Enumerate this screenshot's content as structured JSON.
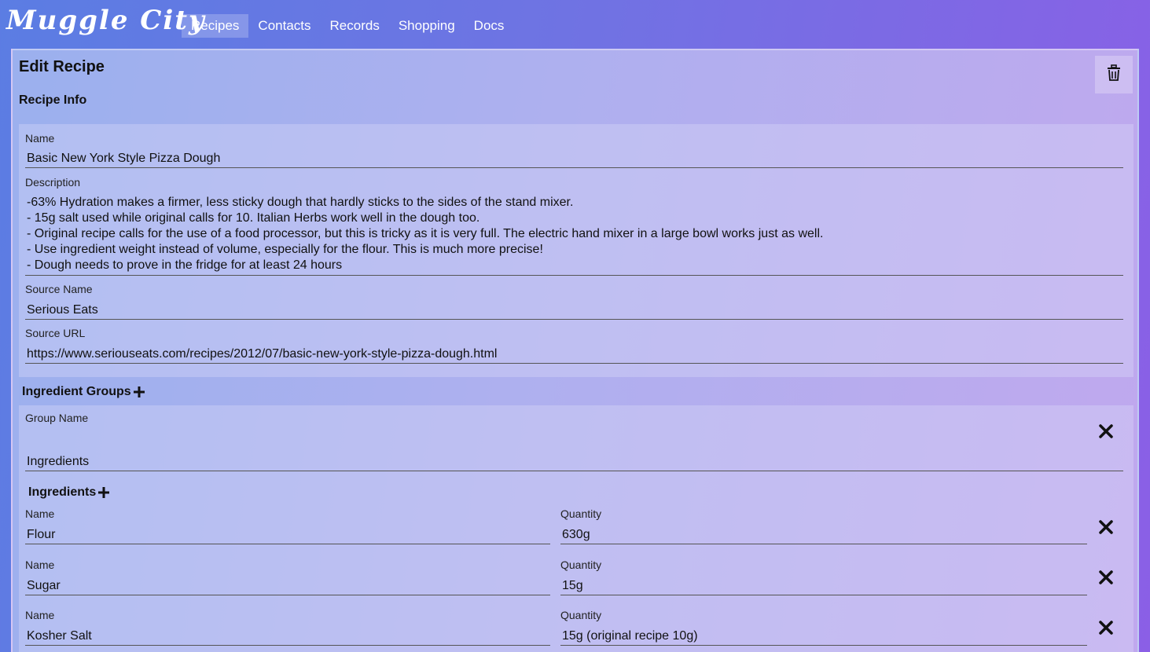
{
  "app": {
    "title": "Muggle City"
  },
  "nav": {
    "tabs": [
      {
        "label": "Recipes",
        "active": true
      },
      {
        "label": "Contacts",
        "active": false
      },
      {
        "label": "Records",
        "active": false
      },
      {
        "label": "Shopping",
        "active": false
      },
      {
        "label": "Docs",
        "active": false
      }
    ]
  },
  "page": {
    "title": "Edit Recipe",
    "section": "Recipe Info",
    "delete_icon": "trash-icon"
  },
  "recipe": {
    "name_label": "Name",
    "name": "Basic New York Style Pizza Dough",
    "description_label": "Description",
    "description": "-63% Hydration makes a firmer, less sticky dough that hardly sticks to the sides of the stand mixer.\n- 15g salt used while original calls for 10. Italian Herbs work well in the dough too.\n- Original recipe calls for the use of a food processor, but this is tricky as it is very full. The electric hand mixer in a large bowl works just as well.\n- Use ingredient weight instead of volume, especially for the flour. This is much more precise!\n- Dough needs to prove in the fridge for at least 24 hours",
    "source_name_label": "Source Name",
    "source_name": "Serious Eats",
    "source_url_label": "Source URL",
    "source_url": "https://www.seriouseats.com/recipes/2012/07/basic-new-york-style-pizza-dough.html"
  },
  "ingredient_groups": {
    "heading": "Ingredient Groups",
    "group_name_label": "Group Name",
    "group_name": "Ingredients",
    "ingredients_heading": "Ingredients",
    "name_label": "Name",
    "quantity_label": "Quantity",
    "items": [
      {
        "name": "Flour",
        "quantity": "630g"
      },
      {
        "name": "Sugar",
        "quantity": "15g"
      },
      {
        "name": "Kosher Salt",
        "quantity": "15g (original recipe 10g)"
      }
    ]
  }
}
